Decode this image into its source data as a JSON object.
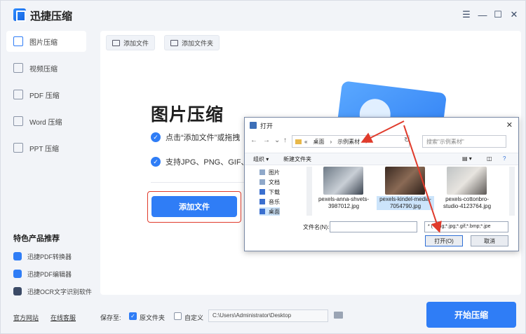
{
  "app": {
    "title": "迅捷压缩"
  },
  "sidebar": {
    "items": [
      {
        "label": "图片压缩"
      },
      {
        "label": "视频压缩"
      },
      {
        "label": "PDF 压缩"
      },
      {
        "label": "Word 压缩"
      },
      {
        "label": "PPT 压缩"
      }
    ],
    "promo_title": "特色产品推荐",
    "promos": [
      {
        "label": "迅捷PDF转换器"
      },
      {
        "label": "迅捷PDF编辑器"
      },
      {
        "label": "迅捷OCR文字识别软件"
      }
    ]
  },
  "toolbar": {
    "add_file": "添加文件",
    "add_folder": "添加文件夹"
  },
  "main": {
    "title": "图片压缩",
    "features": [
      "点击“添加文件”或拖拽",
      "支持JPG、PNG、GIF、B"
    ],
    "add_button": "添加文件"
  },
  "bottom": {
    "website": "官方网站",
    "support": "在线客服",
    "save_to": "保存至:",
    "source_folder": "原文件夹",
    "custom": "自定义",
    "path": "C:\\Users\\Administrator\\Desktop",
    "start": "开始压缩"
  },
  "dialog": {
    "title": "打开",
    "breadcrumb": [
      "«",
      "桌面",
      "›",
      "示例素材",
      "›"
    ],
    "search_placeholder": "搜索\"示例素材\"",
    "organize": "组织 ▾",
    "new_folder": "新建文件夹",
    "tree": [
      {
        "label": "图片"
      },
      {
        "label": "文档"
      },
      {
        "label": "下载"
      },
      {
        "label": "音乐"
      },
      {
        "label": "桌面"
      }
    ],
    "files": [
      {
        "name": "pexels-anna-shvets-3987012.jpg"
      },
      {
        "name": "pexels-kindel-media-7054790.jpg"
      },
      {
        "name": "pexels-cottonbro-studio-4123764.jpg"
      }
    ],
    "filename_label": "文件名(N):",
    "filetype": "* (*.png;*.jpg;*.gif;*.bmp;*.jpe",
    "open": "打开(O)",
    "cancel": "取消"
  },
  "colors": {
    "accent": "#2f7df6",
    "annotation": "#e03b2b"
  }
}
